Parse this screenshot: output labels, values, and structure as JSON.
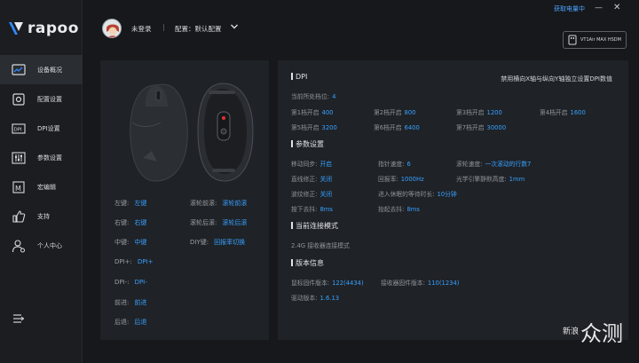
{
  "app": {
    "brand": "rapoo",
    "battery_link": "获取电量中",
    "min_glyph": "—",
    "close_glyph": "✕"
  },
  "sidebar": {
    "items": [
      {
        "label": "设备概况",
        "icon": "chart-icon",
        "active": true
      },
      {
        "label": "配置设置",
        "icon": "settings-icon"
      },
      {
        "label": "DPI设置",
        "icon": "dpi-icon"
      },
      {
        "label": "参数设置",
        "icon": "sliders-icon"
      },
      {
        "label": "宏编辑",
        "icon": "macro-icon"
      },
      {
        "label": "支持",
        "icon": "thumbs-up-icon"
      },
      {
        "label": "个人中心",
        "icon": "user-icon"
      }
    ]
  },
  "header": {
    "login": "未登录",
    "separator": "|",
    "config": "配置：默认配置",
    "device": "VT1Air MAX HSDM"
  },
  "buttons": {
    "left": [
      {
        "k": "左键:",
        "v": "左键"
      },
      {
        "k": "右键:",
        "v": "右键"
      },
      {
        "k": "中键:",
        "v": "中键"
      },
      {
        "k": "DPI+:",
        "v": "DPI+"
      },
      {
        "k": "DPI-:",
        "v": "DPI-"
      },
      {
        "k": "前进:",
        "v": "前进"
      },
      {
        "k": "后退:",
        "v": "后退"
      }
    ],
    "right": [
      {
        "k": "滚轮前滚:",
        "v": "滚轮前滚"
      },
      {
        "k": "滚轮后滚:",
        "v": "滚轮后滚"
      },
      {
        "k": "DIY键:",
        "v": "回报率切换"
      }
    ]
  },
  "dpi": {
    "title": "DPI",
    "hint": "禁用横向X轴与纵向Y轴独立设置DPI数值",
    "current_label": "当前所处档位:",
    "current_value": "4",
    "levels": [
      {
        "k": "第1档开启",
        "v": "400"
      },
      {
        "k": "第2档开启",
        "v": "800"
      },
      {
        "k": "第3档开启",
        "v": "1200"
      },
      {
        "k": "第4档开启",
        "v": "1600"
      },
      {
        "k": "第5档开启",
        "v": "3200"
      },
      {
        "k": "第6档开启",
        "v": "6400"
      },
      {
        "k": "第7档开启",
        "v": "30000"
      }
    ]
  },
  "params": {
    "title": "参数设置",
    "rows": [
      [
        {
          "k": "移动同步:",
          "v": "开启"
        },
        {
          "k": "指针速度:",
          "v": "6"
        },
        {
          "k": "滚轮速度:",
          "v": "一次滚动的行数7"
        }
      ],
      [
        {
          "k": "直线修正:",
          "v": "关闭"
        },
        {
          "k": "回报率:",
          "v": "1000Hz"
        },
        {
          "k": "光学引擎静默高度:",
          "v": "1mm"
        }
      ],
      [
        {
          "k": "波纹修正:",
          "v": "关闭"
        },
        {
          "k": "进入休眠的等待时长:",
          "v": "10分钟"
        }
      ],
      [
        {
          "k": "按下去抖:",
          "v": "8ms"
        },
        {
          "k": "抬起去抖:",
          "v": "8ms"
        }
      ]
    ]
  },
  "connection": {
    "title": "当前连接模式",
    "value": "2.4G 接收器连接模式"
  },
  "version": {
    "title": "版本信息",
    "mouse_fw_label": "鼠标固件版本:",
    "mouse_fw": "122(4434)",
    "receiver_fw_label": "接收器固件版本:",
    "receiver_fw": "110(1234)",
    "driver_label": "驱动版本:",
    "driver": "1.6.13"
  },
  "watermark": {
    "small": "新浪",
    "big": "众测"
  }
}
